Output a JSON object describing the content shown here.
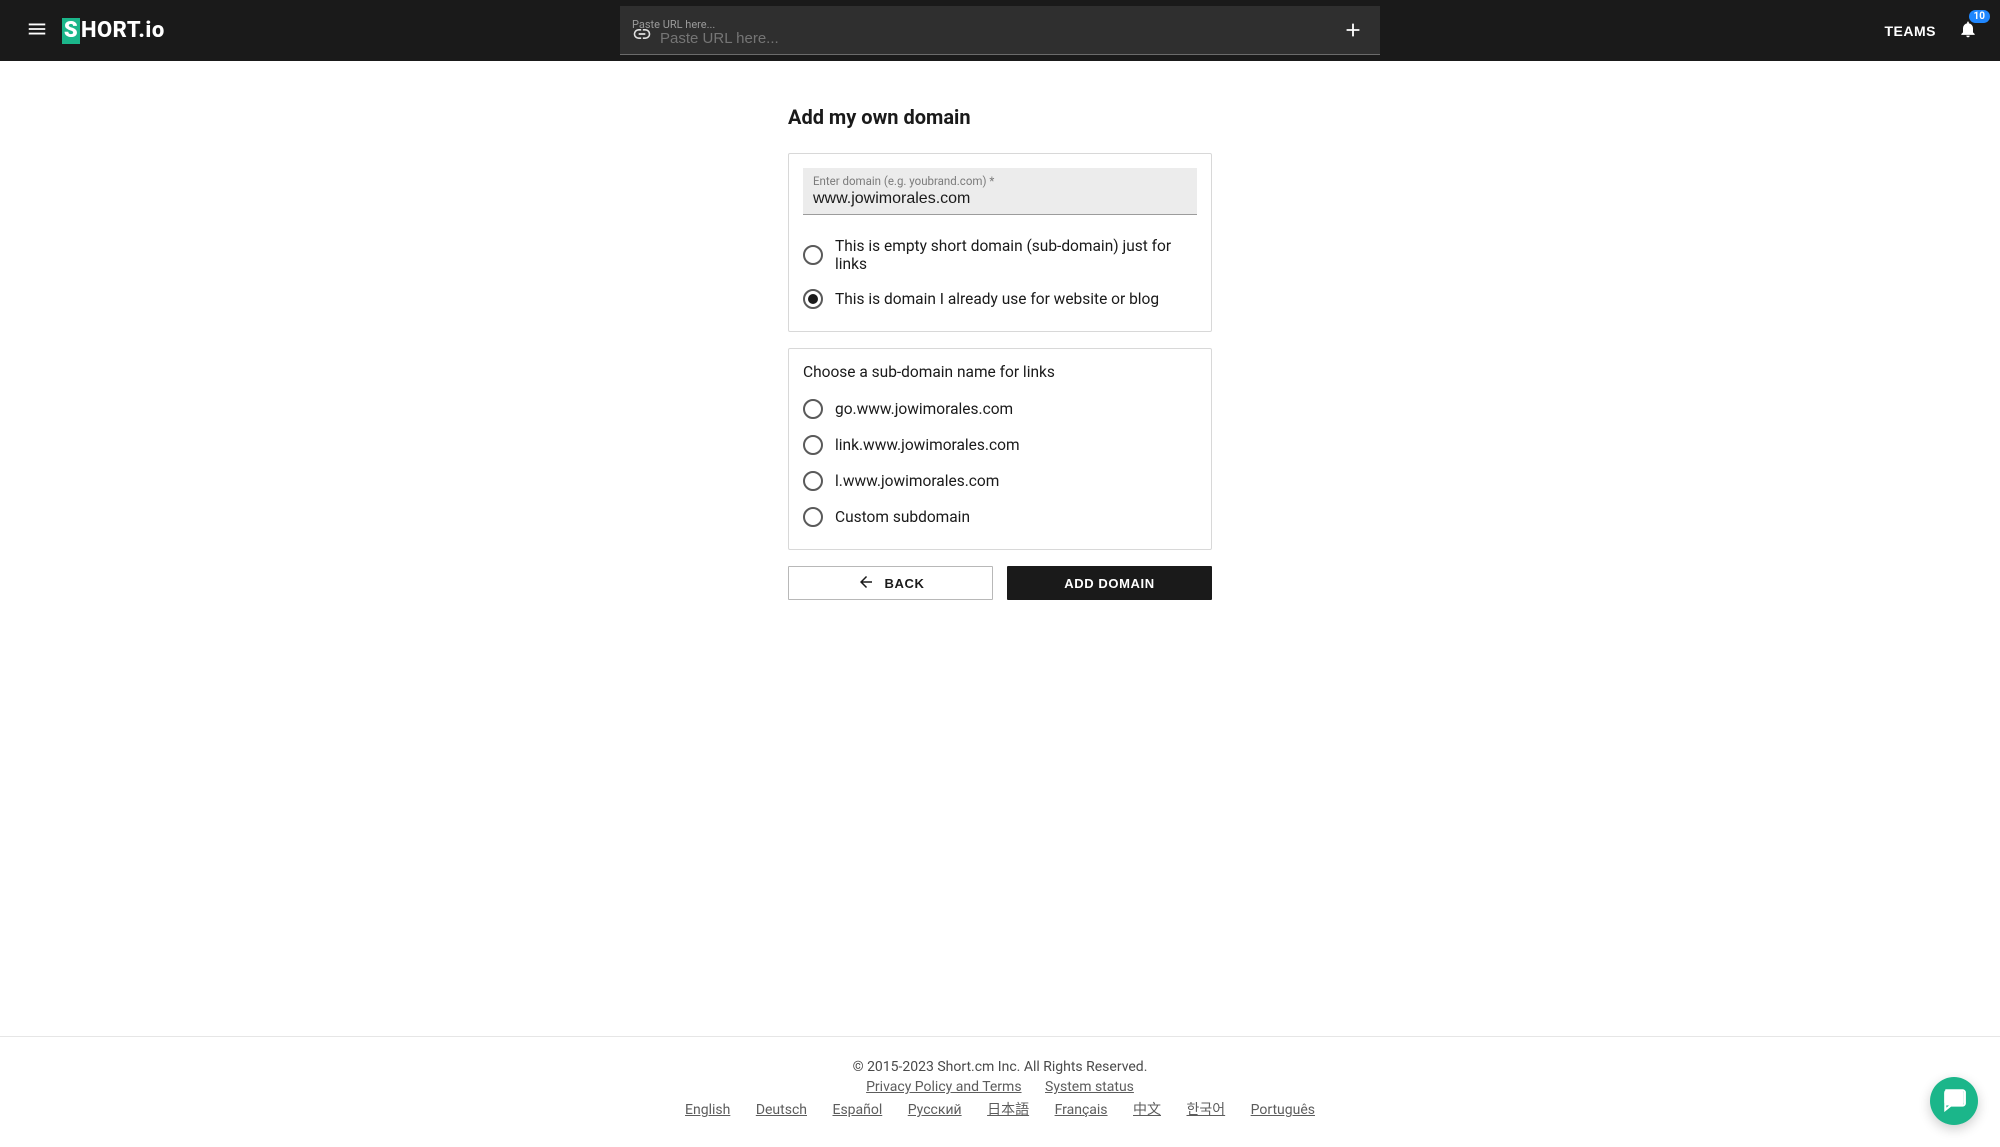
{
  "header": {
    "logo_text": "HORT.io",
    "logo_mark": "S",
    "url_placeholder": "Paste URL here...",
    "teams_label": "TEAMS",
    "notification_count": "10"
  },
  "page": {
    "title": "Add my own domain",
    "domain_field": {
      "label": "Enter domain (e.g. youbrand.com) *",
      "value": "www.jowimorales.com"
    },
    "domain_type": {
      "options": [
        {
          "label": "This is empty short domain (sub-domain) just for links",
          "checked": false
        },
        {
          "label": "This is domain I already use for website or blog",
          "checked": true
        }
      ]
    },
    "subdomain": {
      "title": "Choose a sub-domain name for links",
      "options": [
        {
          "label": "go.www.jowimorales.com",
          "checked": false
        },
        {
          "label": "link.www.jowimorales.com",
          "checked": false
        },
        {
          "label": "l.www.jowimorales.com",
          "checked": false
        },
        {
          "label": "Custom subdomain",
          "checked": false
        }
      ]
    },
    "buttons": {
      "back": "BACK",
      "add": "ADD DOMAIN"
    }
  },
  "footer": {
    "copyright": "© 2015-2023  Short.cm Inc. All Rights Reserved.",
    "privacy": "Privacy Policy and Terms",
    "status": "System status",
    "languages": [
      "English",
      "Deutsch",
      "Español",
      "Русский",
      "日本語",
      "Français",
      "中文",
      "한국어",
      "Português"
    ]
  }
}
